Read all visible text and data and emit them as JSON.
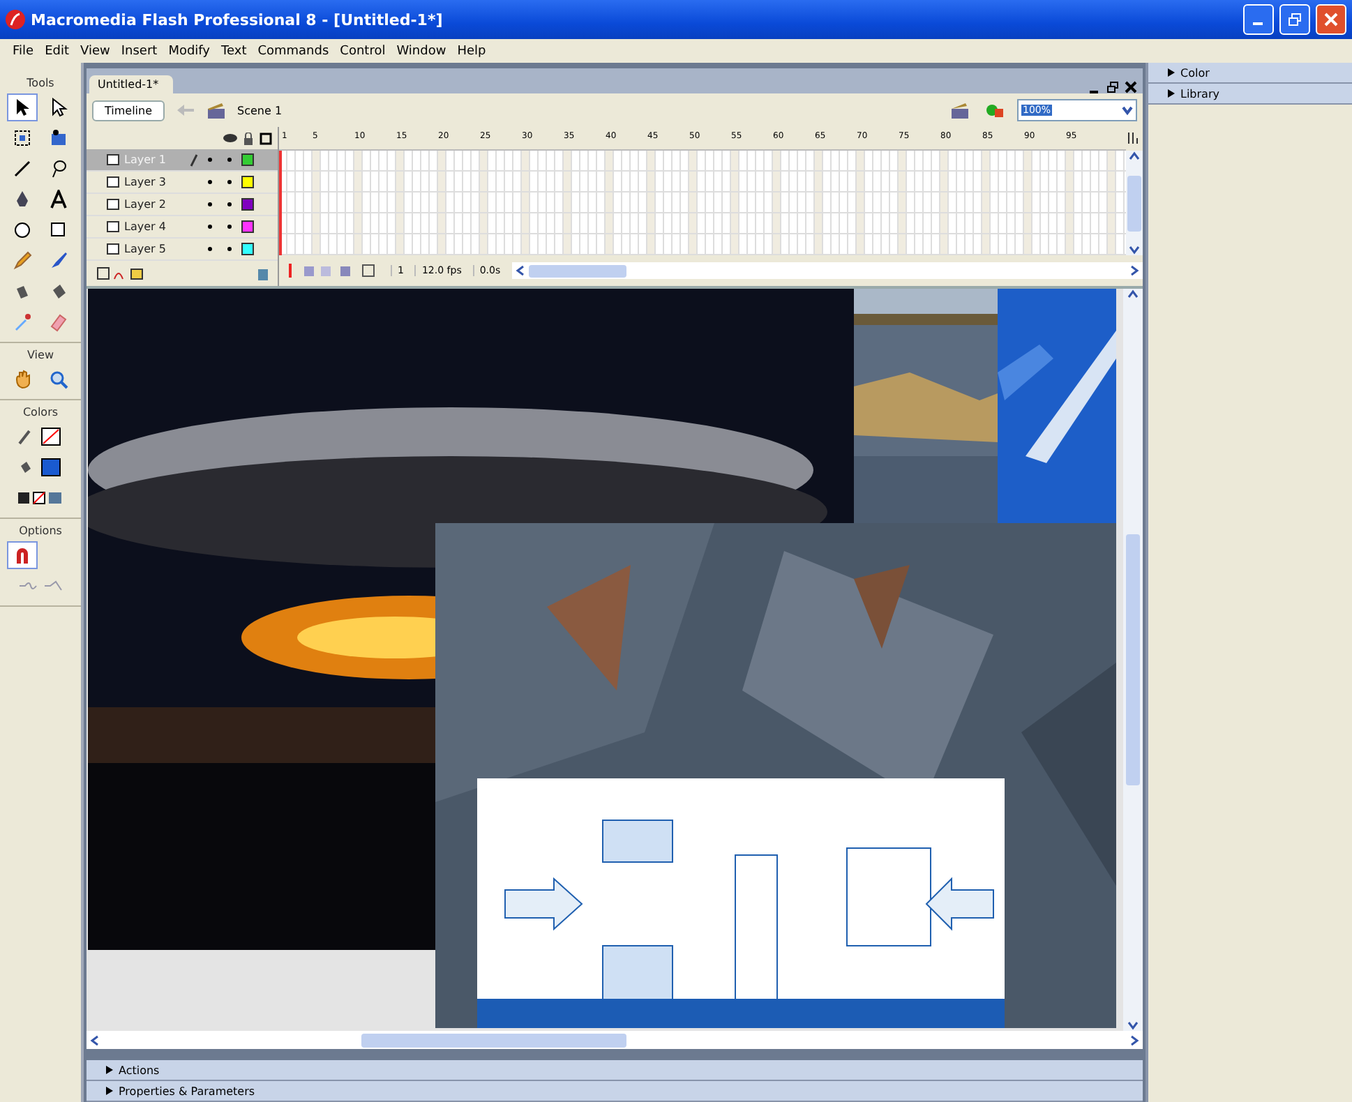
{
  "window": {
    "title": "Macromedia Flash Professional 8 - [Untitled-1*]"
  },
  "menu": [
    "File",
    "Edit",
    "View",
    "Insert",
    "Modify",
    "Text",
    "Commands",
    "Control",
    "Window",
    "Help"
  ],
  "tool_sections": [
    {
      "title": "Tools",
      "tools": [
        {
          "kind": "arrow",
          "selected": true
        },
        {
          "kind": "subselect",
          "selected": false
        },
        {
          "kind": "transform",
          "selected": false
        },
        {
          "kind": "gradient",
          "selected": false
        },
        {
          "kind": "line",
          "selected": false
        },
        {
          "kind": "lasso",
          "selected": false
        },
        {
          "kind": "pen",
          "selected": false
        },
        {
          "kind": "text",
          "selected": false
        },
        {
          "kind": "oval",
          "selected": false
        },
        {
          "kind": "rect",
          "selected": false
        },
        {
          "kind": "pencil",
          "selected": false
        },
        {
          "kind": "brush",
          "selected": false
        },
        {
          "kind": "inkbottle",
          "selected": false
        },
        {
          "kind": "bucket",
          "selected": false
        },
        {
          "kind": "dropper",
          "selected": false
        },
        {
          "kind": "eraser",
          "selected": false
        }
      ]
    },
    {
      "title": "View",
      "tools": [
        {
          "kind": "hand",
          "selected": false
        },
        {
          "kind": "zoom",
          "selected": false
        }
      ]
    },
    {
      "title": "Colors",
      "tools": [
        {
          "kind": "stroke",
          "selected": false
        },
        {
          "kind": "fill",
          "selected": false
        },
        {
          "kind": "swap",
          "selected": false
        }
      ]
    },
    {
      "title": "Options",
      "tools": [
        {
          "kind": "magnet",
          "selected": true
        },
        {
          "kind": "smooth",
          "selected": false
        }
      ]
    }
  ],
  "document": {
    "tab": "Untitled-1*",
    "timeline_button": "Timeline",
    "scene": "Scene 1",
    "zoom": "100%"
  },
  "timeline": {
    "ruler": [
      "1",
      "5",
      "10",
      "15",
      "20",
      "25",
      "30",
      "35",
      "40",
      "45",
      "50",
      "55",
      "60",
      "65",
      "70",
      "75",
      "80",
      "85",
      "90",
      "95"
    ],
    "layers": [
      {
        "name": "Layer 1",
        "selected": true,
        "color": "#33cc33"
      },
      {
        "name": "Layer 3",
        "selected": false,
        "color": "#ffff00"
      },
      {
        "name": "Layer 2",
        "selected": false,
        "color": "#8000c0"
      },
      {
        "name": "Layer 4",
        "selected": false,
        "color": "#ff33ff"
      },
      {
        "name": "Layer 5",
        "selected": false,
        "color": "#33ffff"
      }
    ],
    "current_frame": "1",
    "fps": "12.0 fps",
    "time": "0.0s"
  },
  "stage": {
    "pictures": [
      {
        "kind": "picture"
      },
      {
        "kind": "picture"
      },
      {
        "kind": "picture"
      },
      {
        "kind": "picture"
      },
      {
        "kind": "picture"
      }
    ]
  },
  "bottom_panels": [
    "Actions",
    "Properties & Parameters"
  ],
  "right_panels": [
    "Color",
    "Library"
  ]
}
